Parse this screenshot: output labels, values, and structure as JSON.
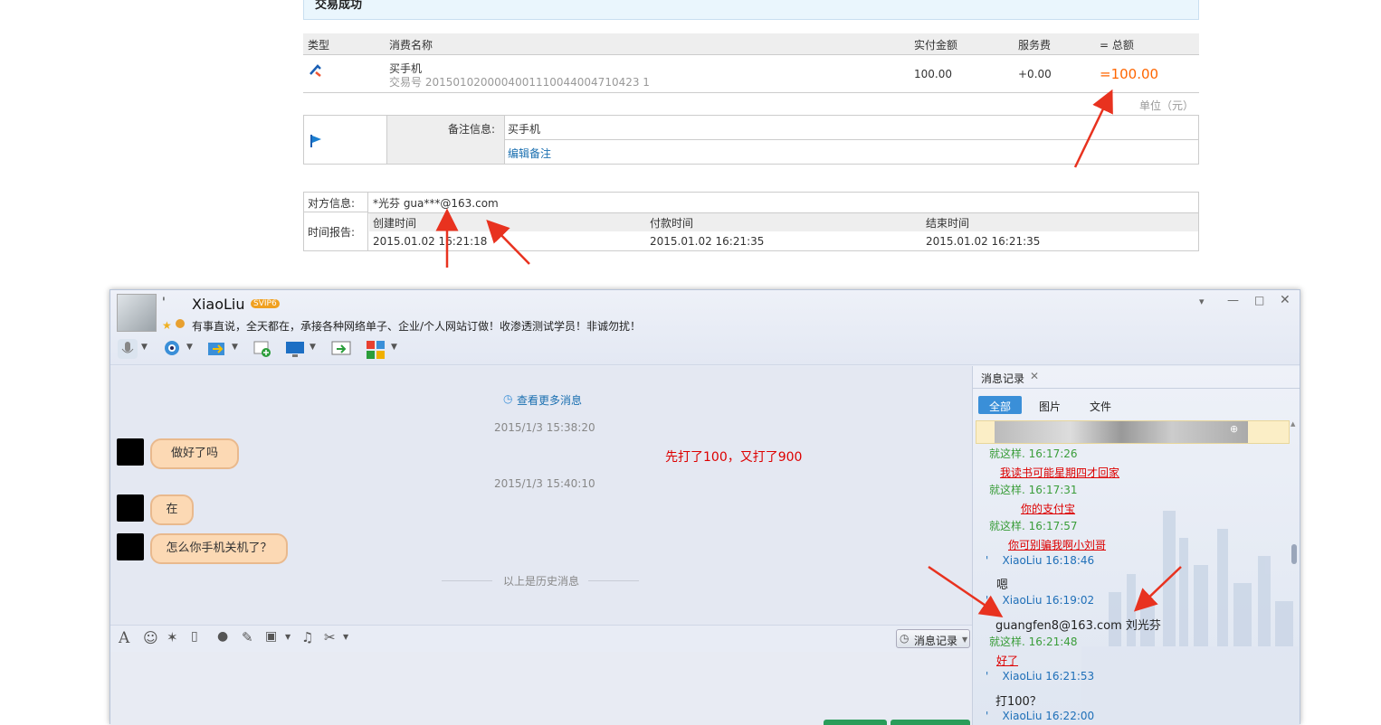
{
  "payment": {
    "banner": "交易成功",
    "headers": [
      "类型",
      "消费名称",
      "实付金额",
      "服务费",
      "= 总额"
    ],
    "item_name": "买手机",
    "trade_no": "交易号 2015010200004001110044004710423 1",
    "amount": "100.00",
    "fee": "+0.00",
    "total": "=100.00",
    "unit": "单位（元）",
    "remark_label": "备注信息:",
    "remark_value": "买手机",
    "edit_remark": "编辑备注",
    "counterparty_label": "对方信息:",
    "counterparty_value": "*光芬 gua***@163.com",
    "time_label": "时间报告:",
    "time_headers": [
      "创建时间",
      "付款时间",
      "结束时间"
    ],
    "time_values": [
      "2015.01.02 16:21:18",
      "2015.01.02 16:21:35",
      "2015.01.02 16:21:35"
    ]
  },
  "chat": {
    "name": "XiaoLiu",
    "name_prefix": "'",
    "vip": "SVIP6",
    "signature": "有事直说，全天都在，承接各种网络单子、企业/个人网站订做！收渗透测试学员！非诚勿扰！",
    "more_messages": "查看更多消息",
    "ts1": "2015/1/3 15:38:20",
    "msg1": "做好了吗",
    "ts2": "2015/1/3 15:40:10",
    "msg2": "在",
    "msg3": "怎么你手机关机了？",
    "history_divider": "以上是历史消息",
    "annotation": "先打了100，又打了900",
    "history_button": "消息记录",
    "side_title": "消息记录",
    "side_tabs": [
      "全部",
      "图片",
      "文件"
    ],
    "records": [
      {
        "who": "就这样. 16:17:26",
        "color": "green",
        "text": "我读书可能星期四才回家",
        "style": "red"
      },
      {
        "who": "就这样. 16:17:31",
        "color": "green",
        "text": "你的支付宝",
        "style": "red"
      },
      {
        "who": "就这样. 16:17:57",
        "color": "green",
        "text": "你可别骗我啊小刘哥",
        "style": "red"
      },
      {
        "who": "'    XiaoLiu 16:18:46",
        "color": "blue",
        "text": "嗯",
        "style": "dark"
      },
      {
        "who": "'    XiaoLiu 16:19:02",
        "color": "blue",
        "text": "guangfen8@163.com 刘光芬",
        "style": "dark"
      },
      {
        "who": "就这样. 16:21:48",
        "color": "green",
        "text": "好了",
        "style": "red"
      },
      {
        "who": "'    XiaoLiu 16:21:53",
        "color": "blue",
        "text": "打100？",
        "style": "dark"
      },
      {
        "who": "'    XiaoLiu 16:22:00",
        "color": "blue",
        "text": "",
        "style": "dark"
      }
    ]
  }
}
